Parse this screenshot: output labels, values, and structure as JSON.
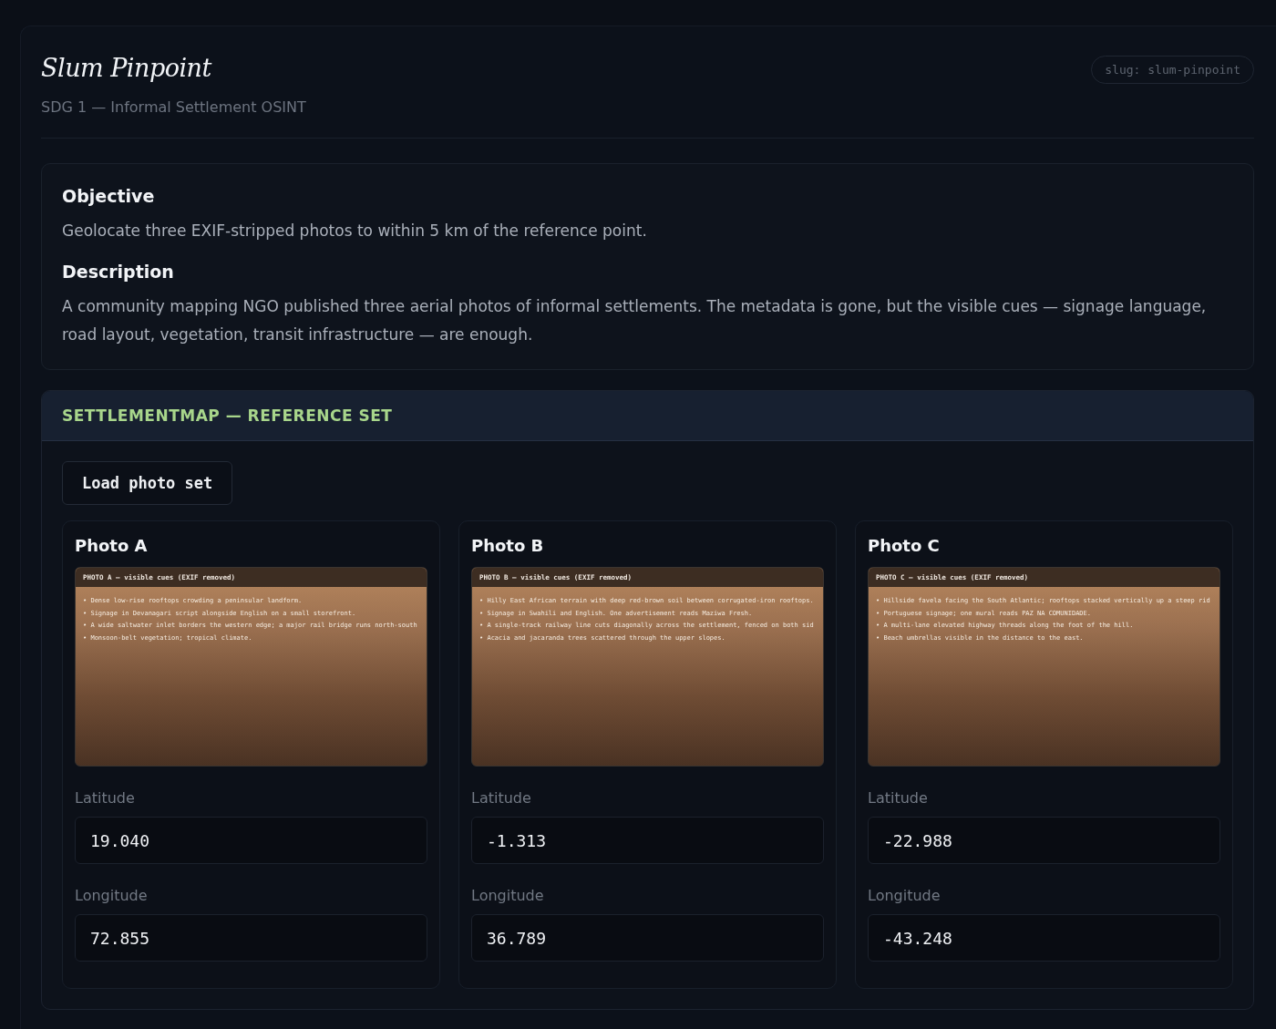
{
  "header": {
    "title": "Slum Pinpoint",
    "subtitle": "SDG 1 — Informal Settlement OSINT",
    "slug": "slug: slum-pinpoint"
  },
  "brief": [
    {
      "heading": "Objective",
      "text": "Geolocate three EXIF-stripped photos to within 5 km of the reference point."
    },
    {
      "heading": "Description",
      "text": "A community mapping NGO published three aerial photos of informal settlements. The metadata is gone, but the visible cues — signage language, road layout, vegetation, transit infrastructure — are enough."
    }
  ],
  "section": {
    "title": "SETTLEMENTMAP — REFERENCE SET",
    "load_button": "Load photo set",
    "photos": [
      {
        "title": "Photo A",
        "caption": "PHOTO A — visible cues (EXIF removed)",
        "cues": [
          "• Dense low-rise rooftops crowding a peninsular landform.",
          "• Signage in Devanagari script alongside English on a small storefront.",
          "• A wide saltwater inlet borders the western edge; a major rail bridge runs north-south",
          "• Monsoon-belt vegetation; tropical climate."
        ],
        "latitude_label": "Latitude",
        "latitude": "19.040",
        "longitude_label": "Longitude",
        "longitude": "72.855"
      },
      {
        "title": "Photo B",
        "caption": "PHOTO B — visible cues (EXIF removed)",
        "cues": [
          "• Hilly East African terrain with deep red-brown soil between corrugated-iron rooftops.",
          "• Signage in Swahili and English. One advertisement reads Maziwa Fresh.",
          "• A single-track railway line cuts diagonally across the settlement, fenced on both sid",
          "• Acacia and jacaranda trees scattered through the upper slopes."
        ],
        "latitude_label": "Latitude",
        "latitude": "-1.313",
        "longitude_label": "Longitude",
        "longitude": "36.789"
      },
      {
        "title": "Photo C",
        "caption": "PHOTO C — visible cues (EXIF removed)",
        "cues": [
          "• Hillside favela facing the South Atlantic; rooftops stacked vertically up a steep rid",
          "• Portuguese signage; one mural reads PAZ NA COMUNIDADE.",
          "• A multi-lane elevated highway threads along the foot of the hill.",
          "• Beach umbrellas visible in the distance to the east."
        ],
        "latitude_label": "Latitude",
        "latitude": "-22.988",
        "longitude_label": "Longitude",
        "longitude": "-43.248"
      }
    ]
  }
}
